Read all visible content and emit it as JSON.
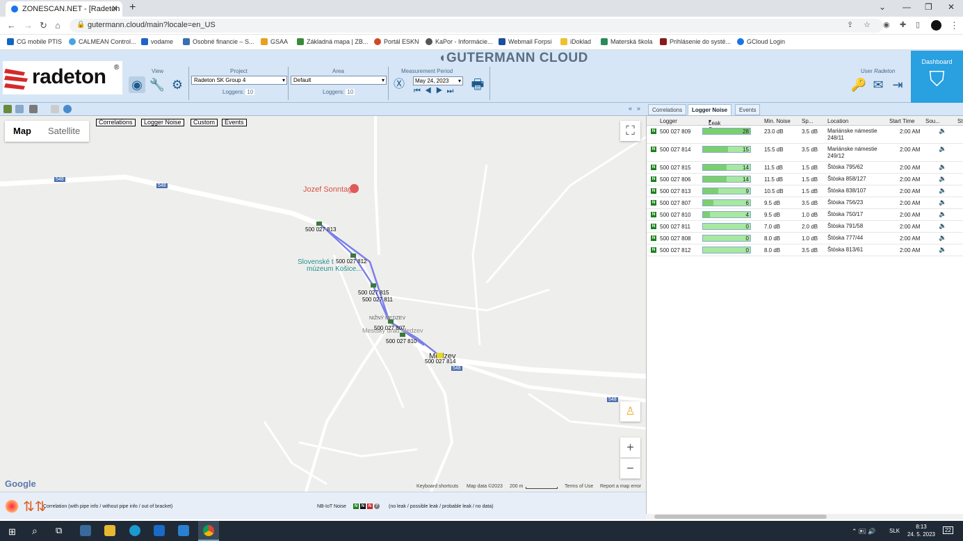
{
  "browser": {
    "tab_title": "ZONESCAN.NET - [Radeton SK G",
    "url": "gutermann.cloud/main?locale=en_US"
  },
  "bookmarks": [
    "CG mobile PTIS",
    "CALMEAN Control...",
    "vodame",
    "Osobné financie – S...",
    "GSAA",
    "Základná mapa | ZB...",
    "Portál ESKN",
    "KaPor - Informácie...",
    "Webmail Forpsi",
    "iDoklad",
    "Materská škola",
    "Prihlásenie do systé...",
    "GCloud Login"
  ],
  "header": {
    "brand": "radeton",
    "cloud_title": "GUTERMANN CLOUD",
    "view_label": "View",
    "project_label": "Project",
    "project_value": "Radeton SK Group 4",
    "loggers_label": "Loggers:",
    "project_loggers": "10",
    "area_label": "Area",
    "area_value": "Default",
    "area_loggers": "10",
    "period_label": "Measurement Period",
    "period_value": "May 24, 2023",
    "user_label": "User",
    "user_name": "Radeton",
    "dashboard": "Dashboard"
  },
  "map": {
    "tab_map": "Map",
    "tab_satellite": "Satellite",
    "buttons": [
      "Correlations",
      "Logger Noise",
      "Custom",
      "Events"
    ],
    "places": {
      "poi1": "Jozef Sonntag",
      "poi2a": "Slovenské t",
      "poi2b": "múzeum Košice...",
      "area1": "NIŽNÝ MEDZEV",
      "area2": "Mestský úrad Medzev",
      "town": "Medzev"
    },
    "loggers": [
      "500 027 813",
      "500 027 812",
      "500 027 815",
      "500 027 811",
      "500 027 806",
      "500 027 807",
      "500 027 810",
      "500 027 814",
      "500 027 809",
      "500 027 808"
    ],
    "footer": {
      "google": "Google",
      "shortcuts": "Keyboard shortcuts",
      "mapdata": "Map data ©2023",
      "scale": "200 m",
      "terms": "Terms of Use",
      "report": "Report a map error"
    }
  },
  "legend": {
    "correlation": "Correlation (with pipe info / without pipe info / out of bracket)",
    "nbiot": "NB-IoT Noise",
    "states": "(no leak / possible leak / probable leak / no data)"
  },
  "panel": {
    "tabs": [
      "Correlations",
      "Logger Noise",
      "Events"
    ],
    "columns": [
      "Logger",
      "Leak Score",
      "Min. Noise",
      "Sp...",
      "Location",
      "Start Time",
      "Sou...",
      "St"
    ],
    "rows": [
      {
        "logger": "500 027 809",
        "score": 28,
        "score_text": "28",
        "min": "23.0 dB",
        "sp": "3.5 dB",
        "loc": "Mariánske námestie 248/11",
        "time": "2:00 AM"
      },
      {
        "logger": "500 027 814",
        "score": 15,
        "score_text": "15",
        "min": "15.5 dB",
        "sp": "3.5 dB",
        "loc": "Mariánske námestie 249/12",
        "time": "2:00 AM"
      },
      {
        "logger": "500 027 815",
        "score": 14,
        "score_text": "14",
        "min": "11.5 dB",
        "sp": "1.5 dB",
        "loc": "Štóska 795/62",
        "time": "2:00 AM"
      },
      {
        "logger": "500 027 806",
        "score": 14,
        "score_text": "14",
        "min": "11.5 dB",
        "sp": "1.5 dB",
        "loc": "Štóska 858/127",
        "time": "2:00 AM"
      },
      {
        "logger": "500 027 813",
        "score": 9,
        "score_text": "9",
        "min": "10.5 dB",
        "sp": "1.5 dB",
        "loc": "Štóska 838/107",
        "time": "2:00 AM"
      },
      {
        "logger": "500 027 807",
        "score": 6,
        "score_text": "6",
        "min": "9.5 dB",
        "sp": "3.5 dB",
        "loc": "Štóska 756/23",
        "time": "2:00 AM"
      },
      {
        "logger": "500 027 810",
        "score": 4,
        "score_text": "4",
        "min": "9.5 dB",
        "sp": "1.0 dB",
        "loc": "Štóska 750/17",
        "time": "2:00 AM"
      },
      {
        "logger": "500 027 811",
        "score": 0,
        "score_text": "0",
        "min": "7.0 dB",
        "sp": "2.0 dB",
        "loc": "Štóska 791/58",
        "time": "2:00 AM"
      },
      {
        "logger": "500 027 808",
        "score": 0,
        "score_text": "0",
        "min": "8.0 dB",
        "sp": "1.0 dB",
        "loc": "Štóska 777/44",
        "time": "2:00 AM"
      },
      {
        "logger": "500 027 812",
        "score": 0,
        "score_text": "0",
        "min": "8.0 dB",
        "sp": "3.5 dB",
        "loc": "Štóska 813/61",
        "time": "2:00 AM"
      }
    ]
  },
  "taskbar": {
    "lang": "SLK",
    "time": "8:13",
    "date": "24. 5. 2023",
    "notif": "22"
  }
}
